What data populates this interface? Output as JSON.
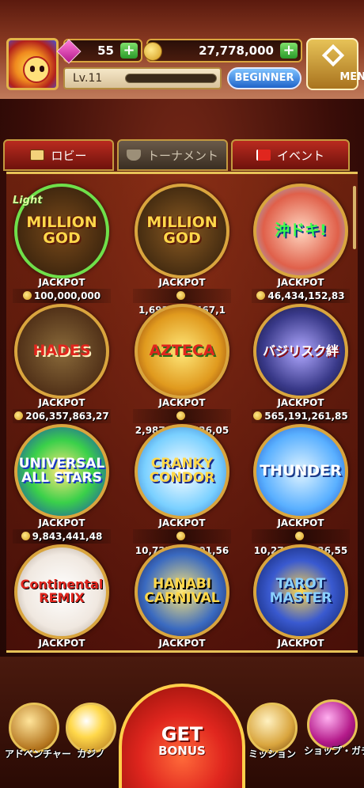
{
  "header": {
    "gems": "55",
    "coins": "27,778,000",
    "level": "Lv.11",
    "rank_badge": "BEGINNER",
    "menu_label": "MENU",
    "plus_label": "+"
  },
  "tabs": [
    {
      "label": "ロビー"
    },
    {
      "label": "トーナメント"
    },
    {
      "label": "イベント"
    }
  ],
  "games": [
    {
      "name": "MILLION GOD",
      "badge": "Light",
      "jackpot_label": "JACKPOT",
      "jackpot": "100,000,000"
    },
    {
      "name": "MILLION GOD",
      "jackpot_label": "JACKPOT",
      "jackpot": "1,693,514,467,1"
    },
    {
      "name": "沖ドキ!",
      "jackpot_label": "JACKPOT",
      "jackpot": "46,434,152,83"
    },
    {
      "name": "HADES",
      "jackpot_label": "JACKPOT",
      "jackpot": "206,357,863,27"
    },
    {
      "name": "AZTECA",
      "jackpot_label": "JACKPOT",
      "jackpot": "2,987,430,626,05"
    },
    {
      "name": "バジリスク絆",
      "jackpot_label": "JACKPOT",
      "jackpot": "565,191,261,85"
    },
    {
      "name": "UNIVERSAL ALL STARS",
      "jackpot_label": "JACKPOT",
      "jackpot": "9,843,441,48"
    },
    {
      "name": "CRANKY CONDOR",
      "jackpot_label": "JACKPOT",
      "jackpot": "10,727,679,01,56"
    },
    {
      "name": "THUNDER",
      "jackpot_label": "JACKPOT",
      "jackpot": "10,273,615,36,55"
    },
    {
      "name": "Continental REMIX",
      "jackpot_label": "JACKPOT",
      "jackpot": ""
    },
    {
      "name": "HANABI CARNIVAL",
      "jackpot_label": "JACKPOT",
      "jackpot": ""
    },
    {
      "name": "TAROT MASTER",
      "jackpot_label": "JACKPOT",
      "jackpot": ""
    }
  ],
  "bottom_nav": {
    "adventure": "アドベンチャー",
    "casino": "カジノ",
    "get": "GET",
    "bonus": "BONUS",
    "mission": "ミッション",
    "shop": "ショップ・ガチャ"
  },
  "colors": {
    "gold_border": "#e7c257",
    "tab_active": "#b92a1f",
    "beginner_blue": "#1e63c9",
    "plus_green": "#2a9a2a"
  }
}
